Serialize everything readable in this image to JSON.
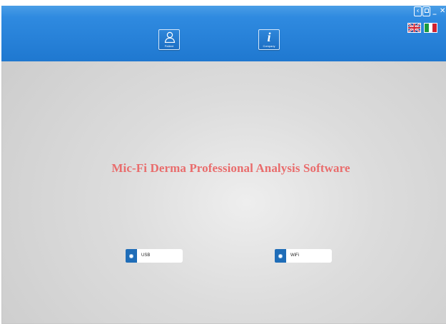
{
  "colors": {
    "header_blue": "#2a84dc",
    "title_red": "#e96c6c",
    "radio_blue": "#1f6db8"
  },
  "window_controls": [
    {
      "name": "back-icon",
      "glyph": "‹"
    },
    {
      "name": "maximize-icon",
      "glyph": ""
    },
    {
      "name": "minimize-icon",
      "glyph": "_"
    },
    {
      "name": "close-icon",
      "glyph": "✕"
    }
  ],
  "nav": {
    "patient": {
      "label": "Patient",
      "icon": "user-icon"
    },
    "company": {
      "label": "Company",
      "icon": "info-icon",
      "glyph": "i"
    }
  },
  "languages": [
    {
      "name": "english",
      "flag": "uk-flag-icon"
    },
    {
      "name": "italian",
      "flag": "italy-flag-icon"
    }
  ],
  "main": {
    "title": "Mic-Fi Derma Professional Analysis Software"
  },
  "connection": {
    "usb_label": "USB",
    "wifi_label": "WiFi"
  }
}
